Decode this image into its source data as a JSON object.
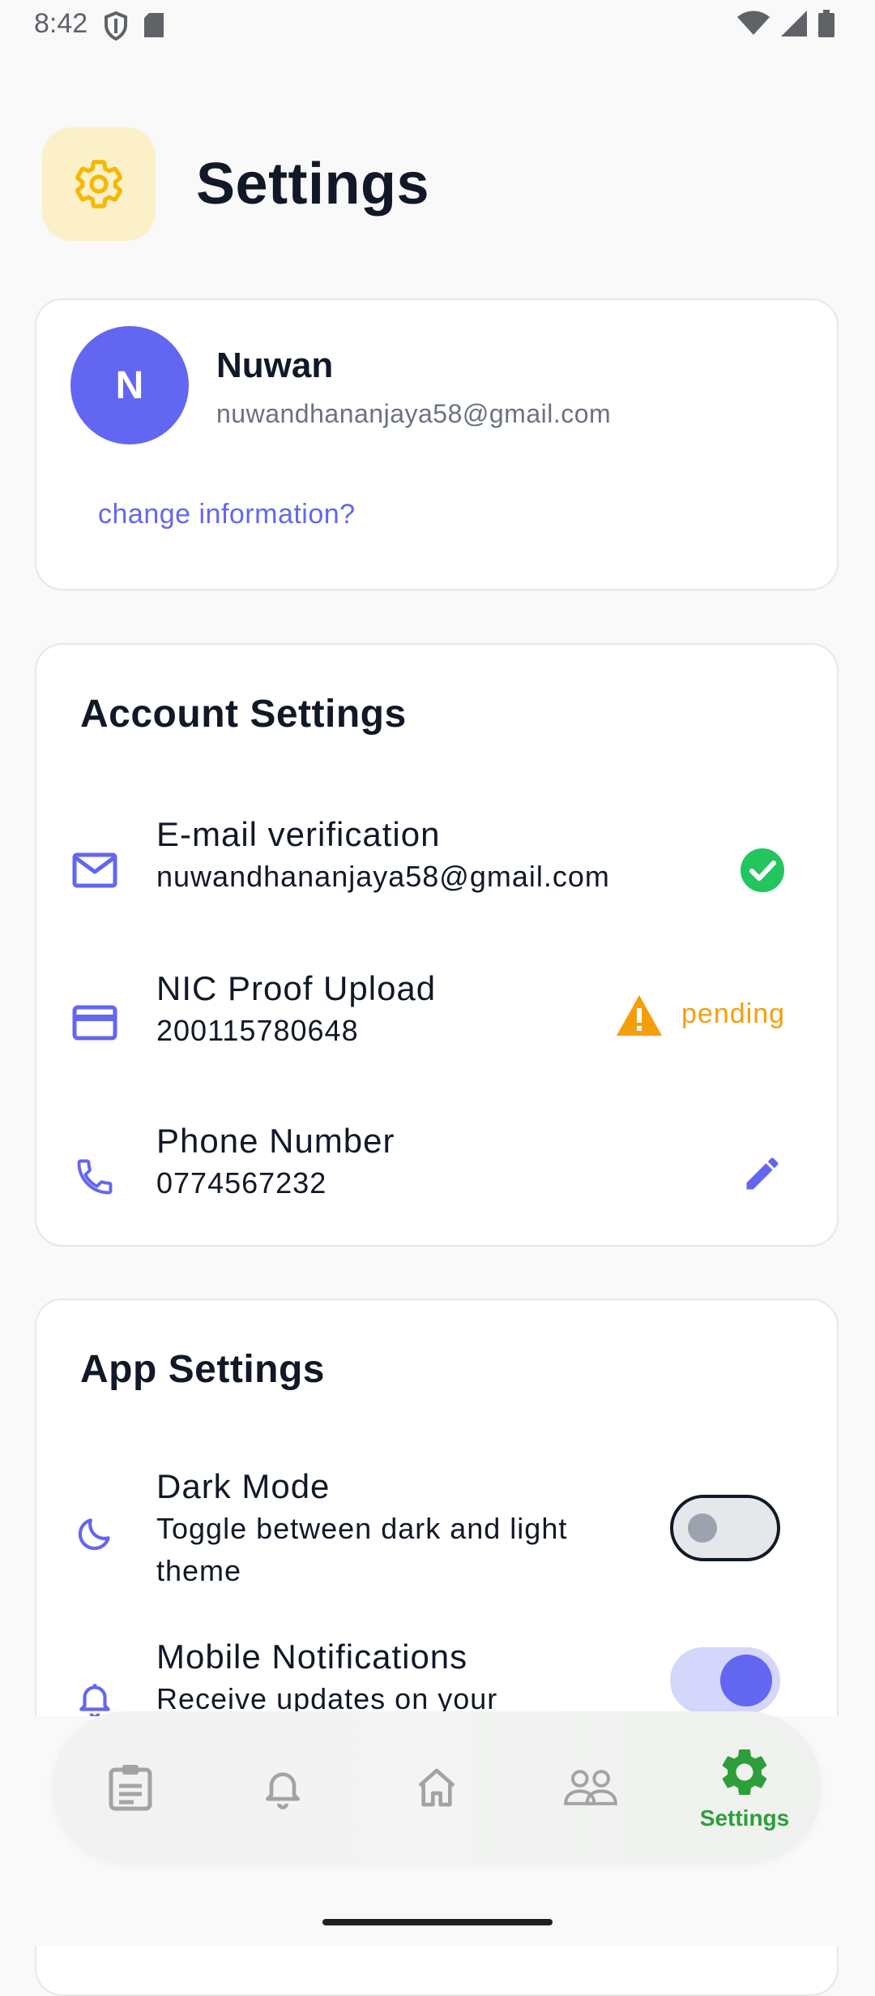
{
  "status_bar": {
    "time": "8:42"
  },
  "header": {
    "title": "Settings"
  },
  "profile": {
    "initial": "N",
    "name": "Nuwan",
    "email": "nuwandhananjaya58@gmail.com",
    "change_link": "change information?"
  },
  "account_settings": {
    "title": "Account Settings",
    "email_verification": {
      "title": "E-mail verification",
      "value": "nuwandhananjaya58@gmail.com"
    },
    "nic": {
      "title": "NIC Proof Upload",
      "value": "200115780648",
      "status": "pending"
    },
    "phone": {
      "title": "Phone Number",
      "value": "0774567232"
    }
  },
  "app_settings": {
    "title": "App Settings",
    "dark_mode": {
      "title": "Dark Mode",
      "desc": "Toggle between dark and light theme",
      "enabled": false
    },
    "notifications": {
      "title": "Mobile Notifications",
      "desc": "Receive updates on your",
      "enabled": true
    }
  },
  "bottom_nav": {
    "items": [
      {
        "icon": "clipboard-icon",
        "label": ""
      },
      {
        "icon": "bell-icon",
        "label": ""
      },
      {
        "icon": "home-icon",
        "label": ""
      },
      {
        "icon": "people-icon",
        "label": ""
      },
      {
        "icon": "gear-icon",
        "label": "Settings",
        "active": true
      }
    ]
  },
  "colors": {
    "accent": "#6366f1",
    "success": "#22c55e",
    "warning": "#f59e0b",
    "nav_active": "#2e9e3a"
  }
}
